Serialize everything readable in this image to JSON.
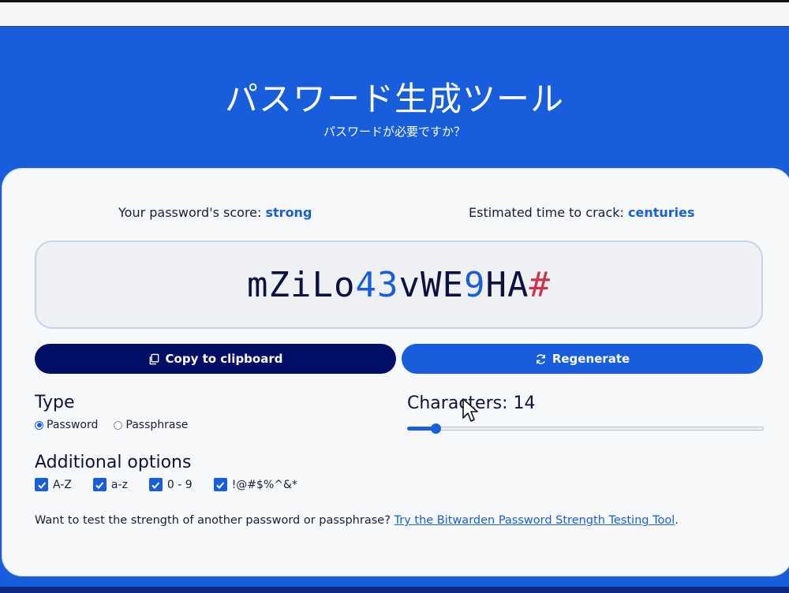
{
  "hero": {
    "title": "パスワード生成ツール",
    "subtitle": "パスワードが必要ですか？"
  },
  "score": {
    "score_label": "Your password's score: ",
    "score_value": "strong",
    "crack_label": "Estimated time to crack: ",
    "crack_value": "centuries"
  },
  "password": {
    "segments": [
      {
        "text": "mZiLo",
        "kind": "letter"
      },
      {
        "text": "43",
        "kind": "number"
      },
      {
        "text": "vWE",
        "kind": "letter"
      },
      {
        "text": "9",
        "kind": "number"
      },
      {
        "text": "HA",
        "kind": "letter"
      },
      {
        "text": "#",
        "kind": "symbol"
      }
    ]
  },
  "buttons": {
    "copy_label": "Copy to clipboard",
    "copy_icon": "copy-icon",
    "regen_label": "Regenerate",
    "regen_icon": "refresh-icon"
  },
  "type_section": {
    "heading": "Type",
    "options": [
      {
        "label": "Password",
        "selected": true
      },
      {
        "label": "Passphrase",
        "selected": false
      }
    ]
  },
  "characters": {
    "label": "Characters: ",
    "value": "14",
    "slider_fraction": 0.08
  },
  "additional": {
    "heading": "Additional options",
    "options": [
      {
        "label": "A-Z",
        "checked": true
      },
      {
        "label": "a-z",
        "checked": true
      },
      {
        "label": "0 - 9",
        "checked": true
      },
      {
        "label": "!@#$%^&*",
        "checked": true
      }
    ]
  },
  "footer": {
    "text": "Want to test the strength of another password or passphrase? ",
    "link": "Try the Bitwarden Password Strength Testing Tool",
    "end": "."
  },
  "colors": {
    "brand_blue": "#175ddc",
    "navy": "#020f66",
    "number": "#175ddc",
    "symbol": "#d0314f"
  }
}
